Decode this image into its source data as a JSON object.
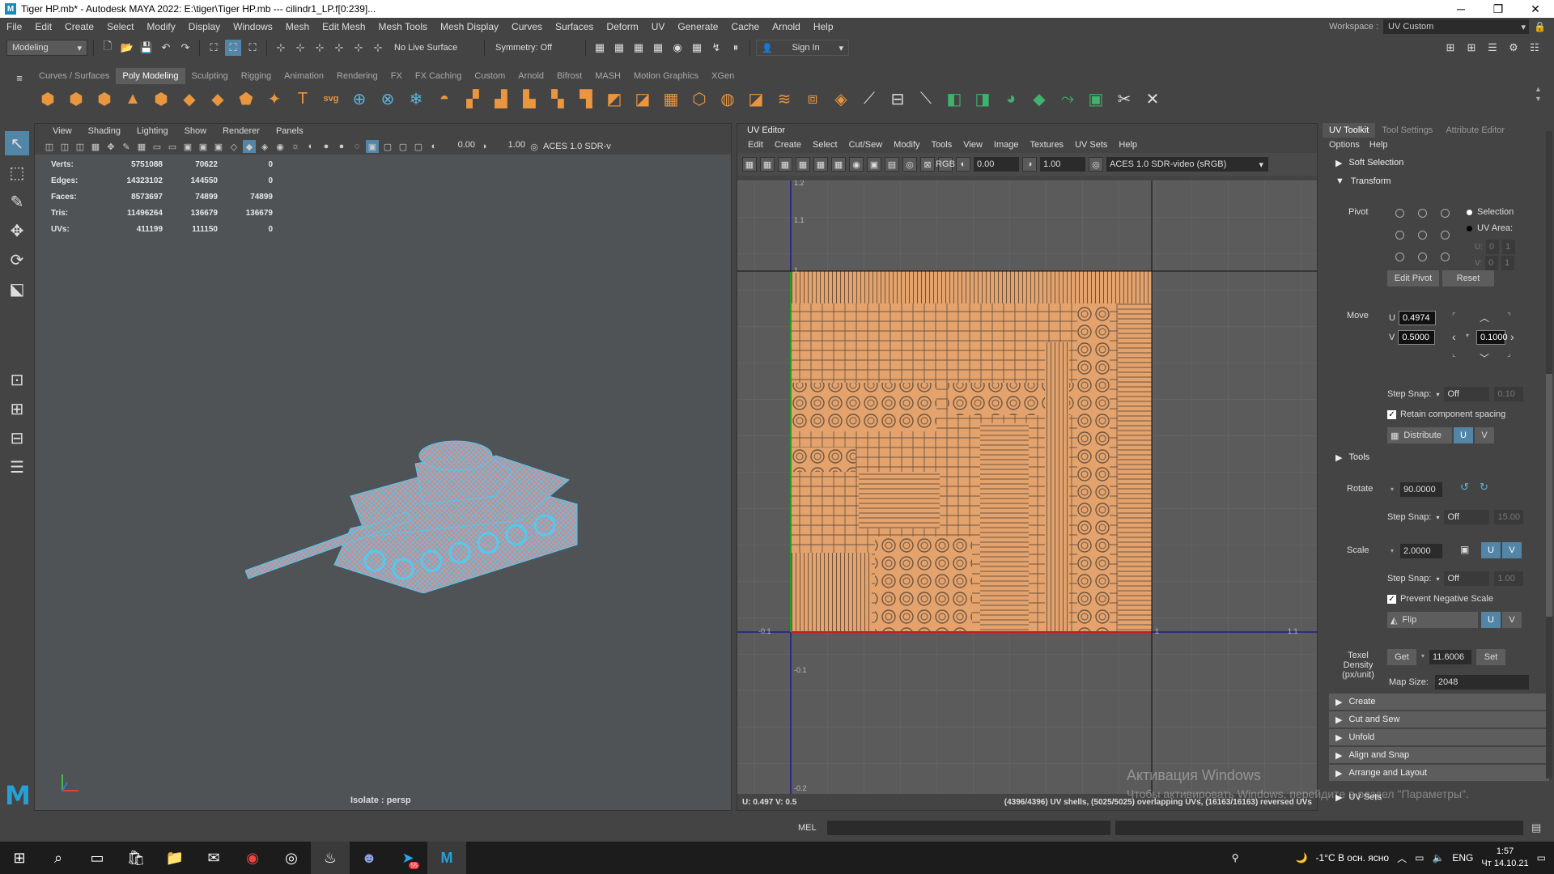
{
  "window": {
    "title": "Tiger HP.mb* - Autodesk MAYA 2022: E:\\tiger\\Tiger HP.mb  ---  cilindr1_LP.f[0:239]...",
    "minimize": "─",
    "restore": "❐",
    "close": "✕"
  },
  "menubar": {
    "items": [
      "File",
      "Edit",
      "Create",
      "Select",
      "Modify",
      "Display",
      "Windows",
      "Mesh",
      "Edit Mesh",
      "Mesh Tools",
      "Mesh Display",
      "Curves",
      "Surfaces",
      "Deform",
      "UV",
      "Generate",
      "Cache",
      "Arnold",
      "Help"
    ],
    "workspace_label": "Workspace :",
    "workspace_value": "UV Custom"
  },
  "statusline": {
    "menuset": "Modeling",
    "live_surface": "No Live Surface",
    "symmetry": "Symmetry: Off",
    "sign_in": "Sign In"
  },
  "shelf": {
    "tabs": [
      "Curves / Surfaces",
      "Poly Modeling",
      "Sculpting",
      "Rigging",
      "Animation",
      "Rendering",
      "FX",
      "FX Caching",
      "Custom",
      "Arnold",
      "Bifrost",
      "MASH",
      "Motion Graphics",
      "XGen"
    ],
    "active_tab": "Poly Modeling"
  },
  "viewport": {
    "menu": [
      "View",
      "Shading",
      "Lighting",
      "Show",
      "Renderer",
      "Panels"
    ],
    "exposure": "0.00",
    "gamma": "1.00",
    "colorspace": "ACES 1.0 SDR-v",
    "hud": [
      {
        "label": "Verts:",
        "a": "5751088",
        "b": "70622",
        "c": "0"
      },
      {
        "label": "Edges:",
        "a": "14323102",
        "b": "144550",
        "c": "0"
      },
      {
        "label": "Faces:",
        "a": "8573697",
        "b": "74899",
        "c": "74899"
      },
      {
        "label": "Tris:",
        "a": "11496264",
        "b": "136679",
        "c": "136679"
      },
      {
        "label": "UVs:",
        "a": "411199",
        "b": "111150",
        "c": "0"
      }
    ],
    "isolate_label": "Isolate : persp"
  },
  "uv_editor": {
    "title": "UV Editor",
    "menu": [
      "Edit",
      "Create",
      "Select",
      "Cut/Sew",
      "Modify",
      "Tools",
      "View",
      "Image",
      "Textures",
      "UV Sets",
      "Help"
    ],
    "exposure": "0.00",
    "gamma": "1.00",
    "colorspace": "ACES 1.0 SDR-video (sRGB)",
    "grid_labels": {
      "top": "1.1",
      "v_one": "1",
      "left": "-0.1",
      "right": "1.1",
      "u_one": "1",
      "bottom": "-0.1",
      "bottom2": "-0.2",
      "top2": "1.2"
    },
    "status_left": "U: 0.497 V: 0.5",
    "status_right": "(4396/4396) UV shells, (5025/5025) overlapping UVs, (16163/16163) reversed UVs"
  },
  "watermark": {
    "line1": "Активация Windows",
    "line2": "Чтобы активировать Windows, перейдите в раздел \"Параметры\"."
  },
  "uv_toolkit": {
    "tabs": [
      "UV Toolkit",
      "Tool Settings",
      "Attribute Editor"
    ],
    "options": [
      "Options",
      "Help"
    ],
    "soft_selection": "Soft Selection",
    "transform": "Transform",
    "pivot_label": "Pivot",
    "pivot_selection": "Selection",
    "pivot_uv_area": "UV Area:",
    "pivot_u_label": "U:",
    "pivot_v_label": "V:",
    "pivot_u_vals": [
      "0",
      "1"
    ],
    "pivot_v_vals": [
      "0",
      "1"
    ],
    "edit_pivot": "Edit Pivot",
    "reset": "Reset",
    "move_label": "Move",
    "move_u_label": "U",
    "move_v_label": "V",
    "move_u": "0.4974",
    "move_v": "0.5000",
    "move_step": "0.1000",
    "step_snap_label": "Step Snap:",
    "step_snap_value": "Off",
    "step_snap_amount": "0.10",
    "retain_spacing": "Retain component spacing",
    "distribute": "Distribute",
    "u_btn": "U",
    "v_btn": "V",
    "tools": "Tools",
    "rotate_label": "Rotate",
    "rotate_value": "90.0000",
    "rotate_step_amount": "15.00",
    "scale_label": "Scale",
    "scale_value": "2.0000",
    "scale_step_amount": "1.00",
    "prevent_negative_scale": "Prevent Negative Scale",
    "flip": "Flip",
    "texel_density_label": "Texel Density (px/unit)",
    "get": "Get",
    "texel_value": "11.6006",
    "set": "Set",
    "map_size_label": "Map Size:",
    "map_size": "2048",
    "collapsed_sections": [
      "Create",
      "Cut and Sew",
      "Unfold",
      "Align and Snap",
      "Arrange and Layout",
      "UV Sets"
    ]
  },
  "cmdline": {
    "label": "MEL"
  },
  "taskbar": {
    "apps": [
      "windows-start",
      "search",
      "task-view",
      "store",
      "explorer",
      "mail",
      "chrome",
      "app-7",
      "steam",
      "discord",
      "telegram",
      "maya"
    ],
    "telegram_badge": "55",
    "weather": "-1°C  В осн. ясно",
    "lang": "ENG",
    "time": "1:57",
    "date": "Чт 14.10.21"
  },
  "colors": {
    "accent": "#5285a6",
    "uv_shell": "#e4a36d",
    "panel": "#444444",
    "wire": "#56c8f0"
  }
}
